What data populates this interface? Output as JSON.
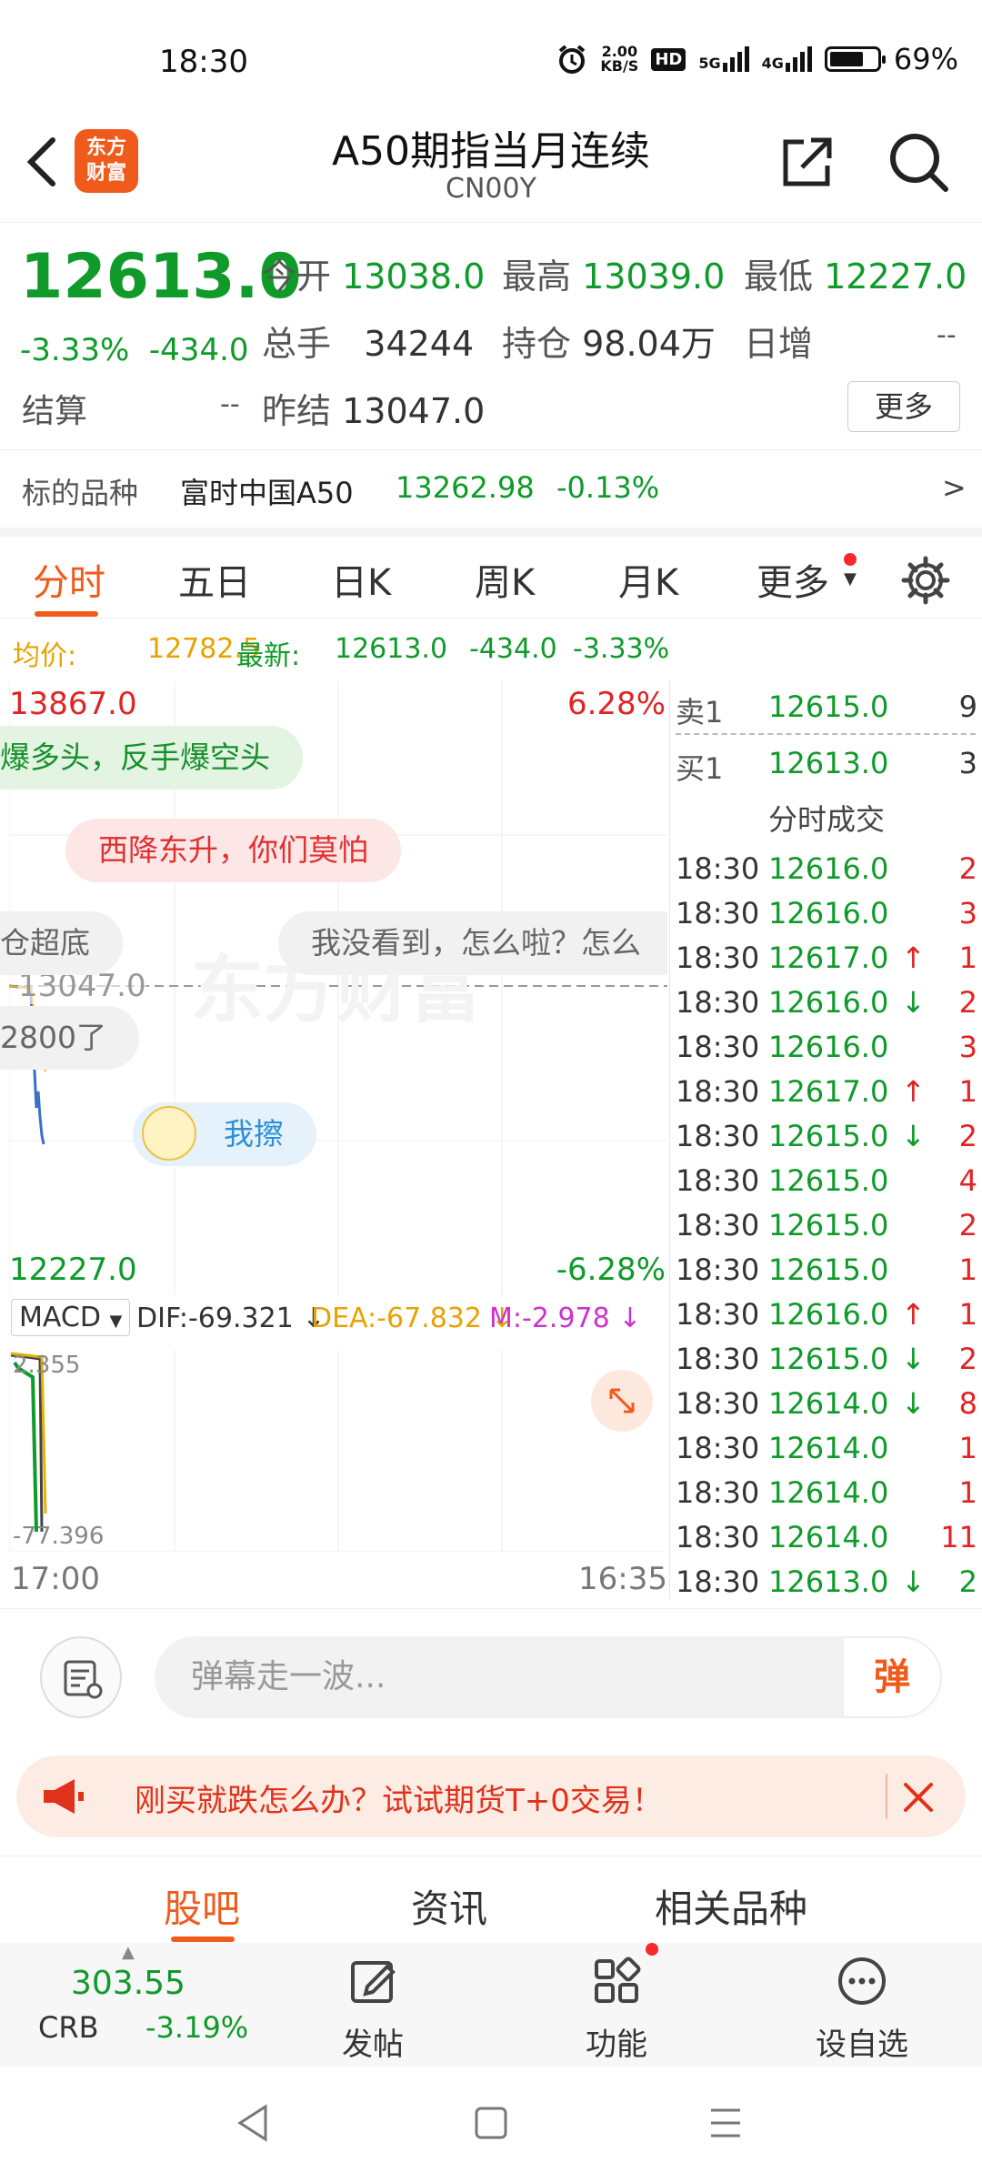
{
  "status_bar": {
    "time": "18:30",
    "net_speed_value": "2.00",
    "net_speed_unit": "KB/S",
    "hd_label": "HD",
    "net1": "5G",
    "net2": "4G",
    "battery": "69%"
  },
  "header": {
    "logo_text_1": "东方",
    "logo_text_2": "财富",
    "title": "A50期指当月连续",
    "code": "CN00Y"
  },
  "quote": {
    "last": "12613.0",
    "change_pct": "-3.33%",
    "change": "-434.0",
    "open_label": "今开",
    "open": "13038.0",
    "high_label": "最高",
    "high": "13039.0",
    "low_label": "最低",
    "low": "12227.0",
    "volume_label": "总手",
    "volume": "34244",
    "oi_label": "持仓",
    "oi": "98.04万",
    "daily_inc_label": "日增",
    "daily_inc": "--",
    "settle_label": "结算",
    "settle": "--",
    "prev_settle_label": "昨结",
    "prev_settle": "13047.0",
    "more_label": "更多"
  },
  "underlying": {
    "label": "标的品种",
    "name": "富时中国A50",
    "price": "13262.98",
    "change_pct": "-0.13%",
    "arrow": ">"
  },
  "tabs": [
    "分时",
    "五日",
    "日K",
    "周K",
    "月K",
    "更多"
  ],
  "avg_line": {
    "avg_label": "均价:",
    "avg": "12782.5",
    "latest_label": "最新:",
    "latest": "12613.0",
    "change": "-434.0",
    "change_pct": "-3.33%"
  },
  "chart": {
    "high_price": "13867.0",
    "high_pct": "6.28%",
    "low_price": "12227.0",
    "low_pct": "-6.28%",
    "ref_price": "13047.0",
    "time_start": "17:00",
    "time_end": "16:35",
    "watermark": "东方财富",
    "danmu": [
      "爆多头，反手爆空头",
      "西降东升，你们莫怕",
      "仓超底",
      "我没看到，怎么啦？怎么",
      "2800了",
      "我擦"
    ],
    "colors": {
      "price_line": "#3d6fc7",
      "avg_line": "#e8b200",
      "up": "#e02424",
      "down": "#0f9a2a"
    }
  },
  "macd": {
    "label": "MACD",
    "dif": "DIF:-69.321",
    "dea": "DEA:-67.832",
    "m": "M:-2.978",
    "axis_top": "2.355",
    "axis_bottom": "-77.396"
  },
  "order_book": {
    "sell": {
      "label": "卖1",
      "price": "12615.0",
      "volume": "9"
    },
    "buy": {
      "label": "买1",
      "price": "12613.0",
      "volume": "3"
    },
    "trades_title": "分时成交",
    "trades": [
      {
        "time": "18:30",
        "price": "12616.0",
        "dir": "",
        "vol": "2"
      },
      {
        "time": "18:30",
        "price": "12616.0",
        "dir": "",
        "vol": "3"
      },
      {
        "time": "18:30",
        "price": "12617.0",
        "dir": "↑",
        "vol": "1"
      },
      {
        "time": "18:30",
        "price": "12616.0",
        "dir": "↓",
        "vol": "2"
      },
      {
        "time": "18:30",
        "price": "12616.0",
        "dir": "",
        "vol": "3"
      },
      {
        "time": "18:30",
        "price": "12617.0",
        "dir": "↑",
        "vol": "1"
      },
      {
        "time": "18:30",
        "price": "12615.0",
        "dir": "↓",
        "vol": "2"
      },
      {
        "time": "18:30",
        "price": "12615.0",
        "dir": "",
        "vol": "4"
      },
      {
        "time": "18:30",
        "price": "12615.0",
        "dir": "",
        "vol": "2"
      },
      {
        "time": "18:30",
        "price": "12615.0",
        "dir": "",
        "vol": "1"
      },
      {
        "time": "18:30",
        "price": "12616.0",
        "dir": "↑",
        "vol": "1"
      },
      {
        "time": "18:30",
        "price": "12615.0",
        "dir": "↓",
        "vol": "2"
      },
      {
        "time": "18:30",
        "price": "12614.0",
        "dir": "↓",
        "vol": "8"
      },
      {
        "time": "18:30",
        "price": "12614.0",
        "dir": "",
        "vol": "1"
      },
      {
        "time": "18:30",
        "price": "12614.0",
        "dir": "",
        "vol": "1"
      },
      {
        "time": "18:30",
        "price": "12614.0",
        "dir": "",
        "vol": "11"
      },
      {
        "time": "18:30",
        "price": "12613.0",
        "dir": "↓",
        "vol": "2"
      }
    ]
  },
  "comment": {
    "placeholder": "弹幕走一波...",
    "send": "弹"
  },
  "promo": {
    "text": "刚买就跌怎么办？试试期货T+0交易！"
  },
  "bottom_tabs": [
    "股吧",
    "资讯",
    "相关品种"
  ],
  "toolbar": {
    "crb_value": "303.55",
    "crb_label": "CRB",
    "crb_change": "-3.19%",
    "post": "发帖",
    "functions": "功能",
    "add_watch": "设自选"
  }
}
